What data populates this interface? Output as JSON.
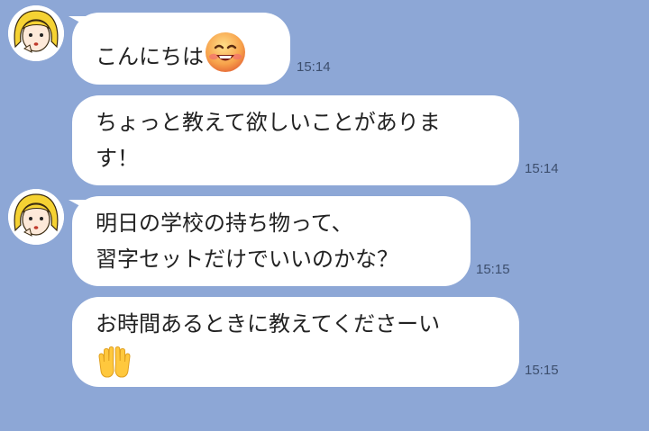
{
  "messages": [
    {
      "text": "こんにちは",
      "time": "15:14"
    },
    {
      "lines": [
        "ちょっと教えて欲しいことがありま",
        "す！"
      ],
      "time": "15:14"
    },
    {
      "lines": [
        "明日の学校の持ち物って、",
        "習字セットだけでいいのかな？"
      ],
      "time": "15:15"
    },
    {
      "lines": [
        "お時間あるときに教えてくださーい"
      ],
      "time": "15:15"
    }
  ],
  "icons": {
    "avatar": "girl-avatar-icon",
    "smile_emoji": "grinning-face-emoji",
    "hands_emoji": "raised-hands-emoji"
  },
  "colors": {
    "background": "#8da7d6",
    "bubble": "#ffffff"
  }
}
